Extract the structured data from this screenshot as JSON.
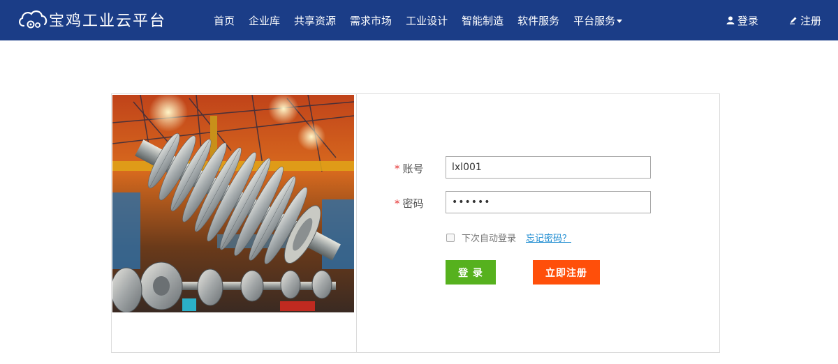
{
  "brand": {
    "name": "宝鸡工业云平台"
  },
  "nav": {
    "items": [
      {
        "label": "首页"
      },
      {
        "label": "企业库"
      },
      {
        "label": "共享资源"
      },
      {
        "label": "需求市场"
      },
      {
        "label": "工业设计"
      },
      {
        "label": "智能制造"
      },
      {
        "label": "软件服务"
      },
      {
        "label": "平台服务"
      }
    ]
  },
  "auth": {
    "login_label": "登录",
    "register_label": "注册"
  },
  "form": {
    "account_label": "账号",
    "account_value": "lxl001",
    "password_label": "密码",
    "password_value": "••••••",
    "required_mark": "*",
    "remember_label": "下次自动登录",
    "forgot_label": "忘记密码？",
    "login_button": "登 录",
    "register_button": "立即注册"
  },
  "colors": {
    "nav_bg": "#1b3d87",
    "login_button": "#56b11e",
    "register_button": "#ff4f0a",
    "link": "#1a8ad0",
    "required": "#e53333"
  }
}
